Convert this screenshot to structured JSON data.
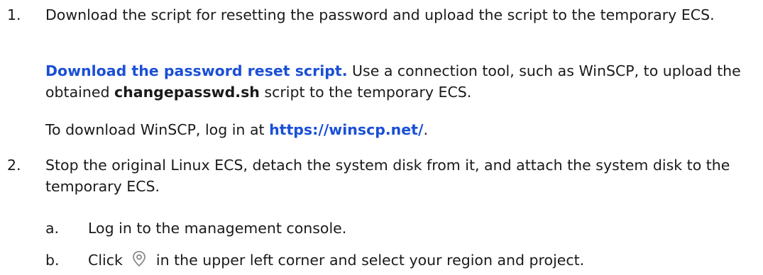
{
  "steps": [
    {
      "number": "1.",
      "text": "Download the script for resetting the password and upload the script to the temporary ECS.",
      "para1": {
        "link": "Download the password reset script.",
        "before_bold": " Use a connection tool, such as WinSCP, to upload the obtained ",
        "bold": "changepasswd.sh",
        "after_bold": " script to the temporary ECS."
      },
      "para2": {
        "before_link": "To download WinSCP, log in at ",
        "link": "https://winscp.net/",
        "after_link": "."
      }
    },
    {
      "number": "2.",
      "text": "Stop the original Linux ECS, detach the system disk from it, and attach the system disk to the temporary ECS.",
      "substeps": [
        {
          "label": "a.",
          "text": "Log in to the management console."
        },
        {
          "label": "b.",
          "before_icon": "Click ",
          "icon": "location-pin-icon",
          "after_icon": " in the upper left corner and select your region and project."
        }
      ]
    }
  ],
  "colors": {
    "link": "#1a4fd6",
    "text": "#1a1a1a",
    "icon": "#8a8a8a"
  }
}
